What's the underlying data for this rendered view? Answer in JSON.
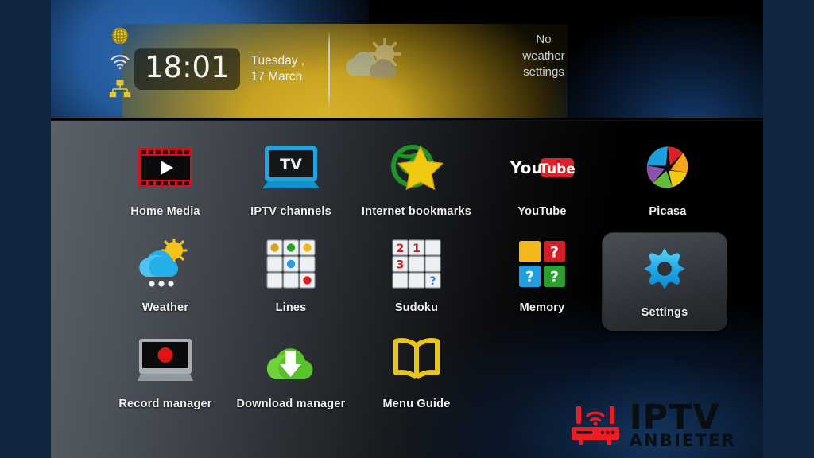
{
  "window": {
    "title": "IPTV Set-Top Box Home Menu",
    "frame_color": "#112441",
    "screen_bg": "#000000"
  },
  "header": {
    "status_icons": [
      {
        "name": "globe-icon",
        "label": "Internet connection",
        "color": "#e8c832"
      },
      {
        "name": "wifi-icon",
        "label": "Wi-Fi signal",
        "color": "#d8dde2"
      },
      {
        "name": "lan-icon",
        "label": "Wired network",
        "color": "#e8c832"
      }
    ],
    "clock": {
      "time": "18:01"
    },
    "date": {
      "weekday": "Tuesday ,",
      "day_month": "17 March"
    },
    "weather": {
      "icon": "cloud-sun-icon",
      "message_lines": [
        "No",
        "weather",
        "settings"
      ],
      "message": "No weather settings"
    }
  },
  "menu": {
    "selected": "Settings",
    "rows": [
      [
        {
          "id": "home-media",
          "label": "Home Media",
          "icon": "film-strip-play-icon",
          "selected": false
        },
        {
          "id": "iptv-channels",
          "label": "IPTV channels",
          "icon": "tv-screen-icon",
          "selected": false
        },
        {
          "id": "internet-bookmarks",
          "label": "Internet bookmarks",
          "icon": "globe-star-icon",
          "selected": false
        },
        {
          "id": "youtube",
          "label": "YouTube",
          "icon": "youtube-logo-icon",
          "selected": false
        },
        {
          "id": "picasa",
          "label": "Picasa",
          "icon": "picasa-shutter-icon",
          "selected": false
        }
      ],
      [
        {
          "id": "weather",
          "label": "Weather",
          "icon": "cloud-sun-rain-icon",
          "selected": false
        },
        {
          "id": "lines",
          "label": "Lines",
          "icon": "grid-balls-icon",
          "selected": false
        },
        {
          "id": "sudoku",
          "label": "Sudoku",
          "icon": "sudoku-grid-icon",
          "selected": false
        },
        {
          "id": "memory",
          "label": "Memory",
          "icon": "memory-tiles-icon",
          "selected": false
        },
        {
          "id": "settings",
          "label": "Settings",
          "icon": "gear-icon",
          "selected": true
        }
      ],
      [
        {
          "id": "record-manager",
          "label": "Record manager",
          "icon": "monitor-record-icon",
          "selected": false
        },
        {
          "id": "download-manager",
          "label": "Download manager",
          "icon": "cloud-download-icon",
          "selected": false
        },
        {
          "id": "menu-guide",
          "label": "Menu Guide",
          "icon": "open-book-icon",
          "selected": false
        }
      ]
    ]
  },
  "watermark": {
    "icon": "router-wifi-icon",
    "line1": "IPTV",
    "line2": "ANBIETER",
    "icon_color": "#ee1b24",
    "text_color": "#0a0d12"
  },
  "icon_colors": {
    "youtube_red": "#d8232a",
    "settings_gear": "#1ea3e8",
    "menu_guide_gold": "#e8c516",
    "download_green": "#57c22a",
    "record_red": "#e01b14",
    "tv_blue": "#1fa5e0",
    "film_red": "#cf1420"
  }
}
